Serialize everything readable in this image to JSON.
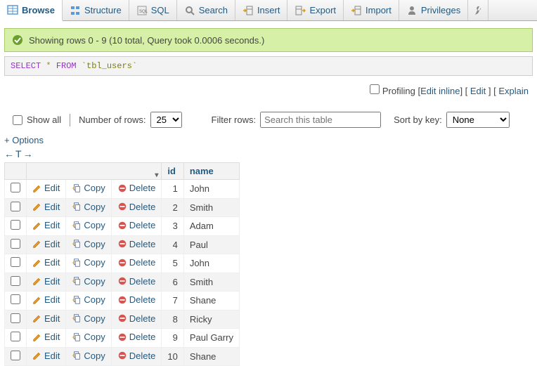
{
  "tabs": [
    {
      "label": "Browse",
      "active": true
    },
    {
      "label": "Structure"
    },
    {
      "label": "SQL"
    },
    {
      "label": "Search"
    },
    {
      "label": "Insert"
    },
    {
      "label": "Export"
    },
    {
      "label": "Import"
    },
    {
      "label": "Privileges"
    }
  ],
  "success_message": "Showing rows 0 - 9 (10 total, Query took 0.0006 seconds.)",
  "query": {
    "select": "SELECT",
    "star": "*",
    "from": "FROM",
    "table": "`tbl_users`"
  },
  "query_actions": {
    "profiling_label": "Profiling",
    "edit_inline": "Edit inline",
    "edit": "Edit",
    "explain": "Explain"
  },
  "controls": {
    "show_all": "Show all",
    "num_rows_label": "Number of rows:",
    "num_rows_value": "25",
    "filter_label": "Filter rows:",
    "filter_placeholder": "Search this table",
    "sort_label": "Sort by key:",
    "sort_value": "None"
  },
  "options_label": "+ Options",
  "columns": {
    "id": "id",
    "name": "name"
  },
  "row_actions": {
    "edit": "Edit",
    "copy": "Copy",
    "delete": "Delete"
  },
  "rows": [
    {
      "id": "1",
      "name": "John"
    },
    {
      "id": "2",
      "name": "Smith"
    },
    {
      "id": "3",
      "name": "Adam"
    },
    {
      "id": "4",
      "name": "Paul"
    },
    {
      "id": "5",
      "name": "John"
    },
    {
      "id": "6",
      "name": "Smith"
    },
    {
      "id": "7",
      "name": "Shane"
    },
    {
      "id": "8",
      "name": "Ricky"
    },
    {
      "id": "9",
      "name": "Paul Garry"
    },
    {
      "id": "10",
      "name": "Shane"
    }
  ]
}
